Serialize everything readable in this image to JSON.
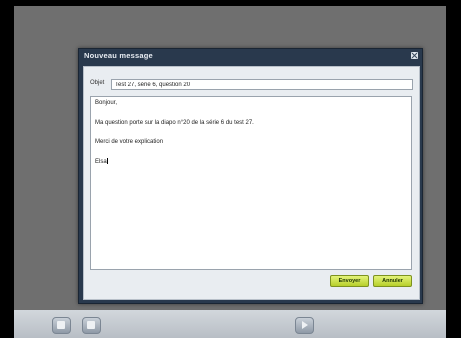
{
  "dialog": {
    "title": "Nouveau message",
    "subject_label": "Objet",
    "subject_value": "Test 27, série 6, question 20",
    "message_lines": [
      "Bonjour,",
      "Ma question porte sur la diapo n°20 de la série 6 du test 27.",
      "Merci de votre explication",
      "Elsa"
    ],
    "send_label": "Envoyer",
    "cancel_label": "Annuler"
  },
  "icons": {
    "close": "close-icon",
    "bottom_left_1": "document-icon",
    "bottom_left_2": "folder-icon",
    "bottom_center": "play-icon"
  },
  "colors": {
    "modal_bg": "#29394d",
    "button_accent": "#c7df3a"
  }
}
